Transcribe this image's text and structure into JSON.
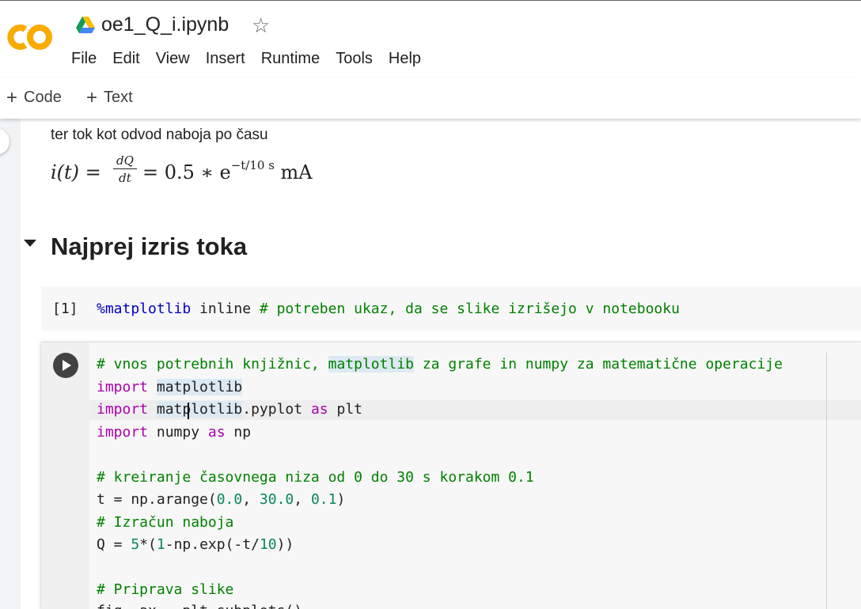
{
  "header": {
    "notebook_title": "oe1_Q_i.ipynb",
    "logo_text": "CO",
    "menu": [
      "File",
      "Edit",
      "View",
      "Insert",
      "Runtime",
      "Tools",
      "Help"
    ]
  },
  "toolbar": {
    "add_code_label": "Code",
    "add_text_label": "Text"
  },
  "markdown": {
    "text": "ter tok kot odvod naboja po času",
    "formula": {
      "lhs": "i(t) =",
      "frac_num": "dQ",
      "frac_den": "dt",
      "rhs": "= 0.5 ∗ e",
      "exponent": "−t/10 s",
      "unit": "mA"
    }
  },
  "section": {
    "title": "Najprej izris toka"
  },
  "cell1": {
    "execution_count": "[1]",
    "magic": "%matplotlib",
    "rest": " inline ",
    "comment": "# potreben ukaz, da se slike izrišejo v notebooku"
  },
  "cell2": {
    "lines": {
      "l1_a": "# vnos potrebnih knjižnic, ",
      "l1_b": "matplotlib",
      "l1_c": " za grafe in numpy za matematične operacije",
      "l2_kw": "import",
      "l2_a": " ",
      "l2_b": "matplotlib",
      "l3_kw": "import",
      "l3_a": " ",
      "l3_b": "matplotlib",
      "l3_c": ".pyplot ",
      "l3_kw2": "as",
      "l3_d": " plt",
      "l4_kw": "import",
      "l4_a": " numpy ",
      "l4_kw2": "as",
      "l4_b": " np",
      "l6": "# kreiranje časovnega niza od 0 do 30 s korakom 0.1",
      "l7_a": "t = np.arange(",
      "l7_n1": "0.0",
      "l7_b": ", ",
      "l7_n2": "30.0",
      "l7_c": ", ",
      "l7_n3": "0.1",
      "l7_d": ")",
      "l8": "# Izračun naboja",
      "l9_a": "Q = ",
      "l9_n1": "5",
      "l9_b": "*(",
      "l9_n2": "1",
      "l9_c": "-np.exp(-t/",
      "l9_n3": "10",
      "l9_d": "))",
      "l11": "# Priprava slike",
      "l12": "fig, ax = plt.subplots()"
    }
  },
  "colors": {
    "comment": "#008000",
    "keyword": "#aa00aa",
    "number": "#098658",
    "magic": "#0000c0",
    "logo": "#f9ab00"
  },
  "icons": [
    "colab-logo",
    "drive-icon",
    "star-icon",
    "plus-icon",
    "run-icon",
    "collapse-icon"
  ]
}
